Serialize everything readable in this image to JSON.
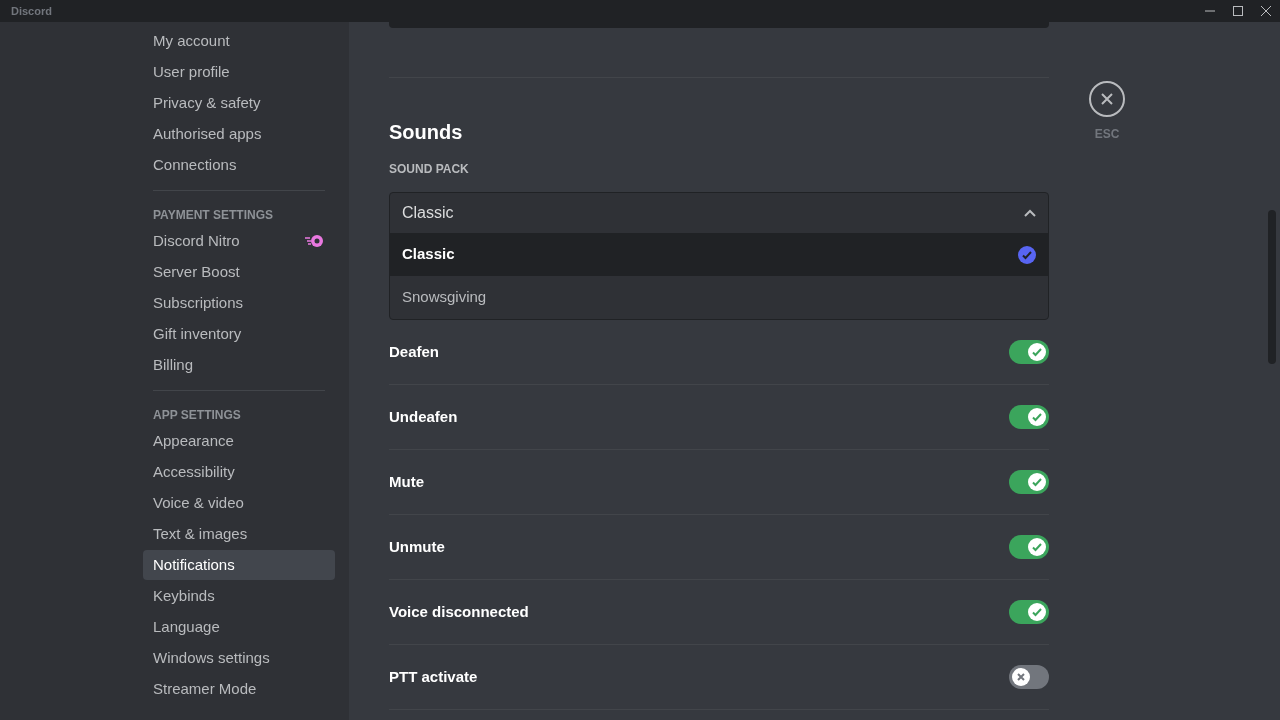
{
  "window": {
    "title": "Discord"
  },
  "sidebar": {
    "groups": [
      {
        "items": [
          {
            "label": "My account",
            "selected": false
          },
          {
            "label": "User profile",
            "selected": false
          },
          {
            "label": "Privacy & safety",
            "selected": false
          },
          {
            "label": "Authorised apps",
            "selected": false
          },
          {
            "label": "Connections",
            "selected": false
          }
        ]
      },
      {
        "header": "PAYMENT SETTINGS",
        "items": [
          {
            "label": "Discord Nitro",
            "selected": false,
            "badge": true
          },
          {
            "label": "Server Boost",
            "selected": false
          },
          {
            "label": "Subscriptions",
            "selected": false
          },
          {
            "label": "Gift inventory",
            "selected": false
          },
          {
            "label": "Billing",
            "selected": false
          }
        ]
      },
      {
        "header": "APP SETTINGS",
        "items": [
          {
            "label": "Appearance",
            "selected": false
          },
          {
            "label": "Accessibility",
            "selected": false
          },
          {
            "label": "Voice & video",
            "selected": false
          },
          {
            "label": "Text & images",
            "selected": false
          },
          {
            "label": "Notifications",
            "selected": true
          },
          {
            "label": "Keybinds",
            "selected": false
          },
          {
            "label": "Language",
            "selected": false
          },
          {
            "label": "Windows settings",
            "selected": false
          },
          {
            "label": "Streamer Mode",
            "selected": false
          }
        ]
      }
    ]
  },
  "sounds": {
    "title": "Sounds",
    "sound_pack_label": "SOUND PACK",
    "sound_pack": {
      "value": "Classic",
      "expanded": true,
      "options": [
        {
          "label": "Classic",
          "selected": true
        },
        {
          "label": "Snowsgiving",
          "selected": false
        }
      ]
    },
    "toggles": [
      {
        "label": "Deafen",
        "on": true
      },
      {
        "label": "Undeafen",
        "on": true
      },
      {
        "label": "Mute",
        "on": true
      },
      {
        "label": "Unmute",
        "on": true
      },
      {
        "label": "Voice disconnected",
        "on": true
      },
      {
        "label": "PTT activate",
        "on": false
      }
    ]
  },
  "close": {
    "label": "ESC"
  }
}
